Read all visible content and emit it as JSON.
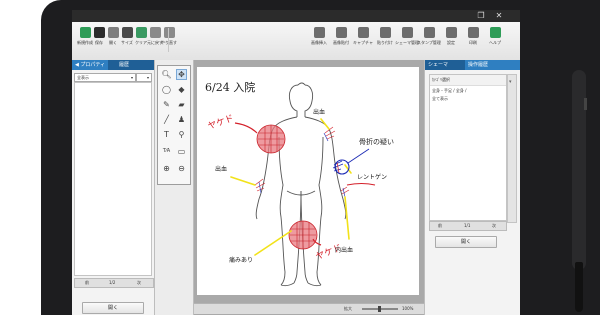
{
  "window": {
    "minimize_icon": "restore-icon",
    "close_label": "✕"
  },
  "toolbar": {
    "left_items": [
      {
        "label": "新規作成",
        "icon": "new-document-icon",
        "color": "#2e9c57"
      },
      {
        "label": "保存",
        "icon": "save-icon",
        "color": "#2c2c2c"
      },
      {
        "label": "開く",
        "icon": "open-icon",
        "color": "#7d7d7d"
      },
      {
        "label": "サイズ",
        "icon": "size-icon",
        "color": "#4a4a4a"
      },
      {
        "label": "クリア",
        "icon": "clear-icon",
        "color": "#3a9a62"
      },
      {
        "label": "元に戻す",
        "icon": "undo-icon",
        "color": "#8a8a8a"
      },
      {
        "label": "やり直す",
        "icon": "redo-icon",
        "color": "#8a8a8a"
      }
    ],
    "right_items": [
      {
        "label": "画像挿入",
        "icon": "insert-image-icon",
        "color": "#6d6d6d"
      },
      {
        "label": "画像貼付",
        "icon": "paste-image-icon",
        "color": "#6d6d6d"
      },
      {
        "label": "キャプチャ",
        "icon": "capture-icon",
        "color": "#6d6d6d"
      },
      {
        "label": "貼り付け",
        "icon": "paste-icon",
        "color": "#6d6d6d"
      },
      {
        "label": "シェーマ管理",
        "icon": "schema-manage-icon",
        "color": "#6d6d6d"
      },
      {
        "label": "スタンプ管理",
        "icon": "stamp-manage-icon",
        "color": "#6d6d6d"
      },
      {
        "label": "設定",
        "icon": "settings-icon",
        "color": "#6d6d6d"
      },
      {
        "label": "印刷",
        "icon": "print-icon",
        "color": "#6d6d6d"
      },
      {
        "label": "ヘルプ",
        "icon": "help-icon",
        "color": "#2e9c57"
      }
    ]
  },
  "left_panel": {
    "tab_properties": "◀ プロパティ",
    "tab_history": "履歴",
    "filter_value": "全表示",
    "pager_first": "前",
    "pager_page": "1/2",
    "pager_next": "次",
    "open_button": "開く"
  },
  "right_panel": {
    "tab_schema": "シェーマ",
    "tab_history": "操作履歴",
    "list_header": "ｶﾃｺﾞﾘ選択",
    "list_items": [
      "全身・手足 / 全身 /",
      "全て表示"
    ],
    "pager_first": "前",
    "pager_page": "1/1",
    "pager_next": "次",
    "open_button": "開く"
  },
  "drawing": {
    "date_title": "6/24 入院",
    "burn_label_1": "ヤケド",
    "burn_label_2": "ヤケド",
    "bleeding_shoulder": "出血",
    "bleeding_left_arm": "出血",
    "fracture_suspect": "骨折の疑い",
    "xray_note": "レントゲン",
    "internal_bleeding": "内出血",
    "pain_present": "痛みあり",
    "colors": {
      "red_ink": "#d4202a",
      "blue_ink": "#1c2bb5",
      "yellow_marker": "#f2e21a",
      "body_outline": "#555555"
    }
  },
  "canvas_status": {
    "zoom_label": "拡大",
    "zoom_level": "100%"
  }
}
